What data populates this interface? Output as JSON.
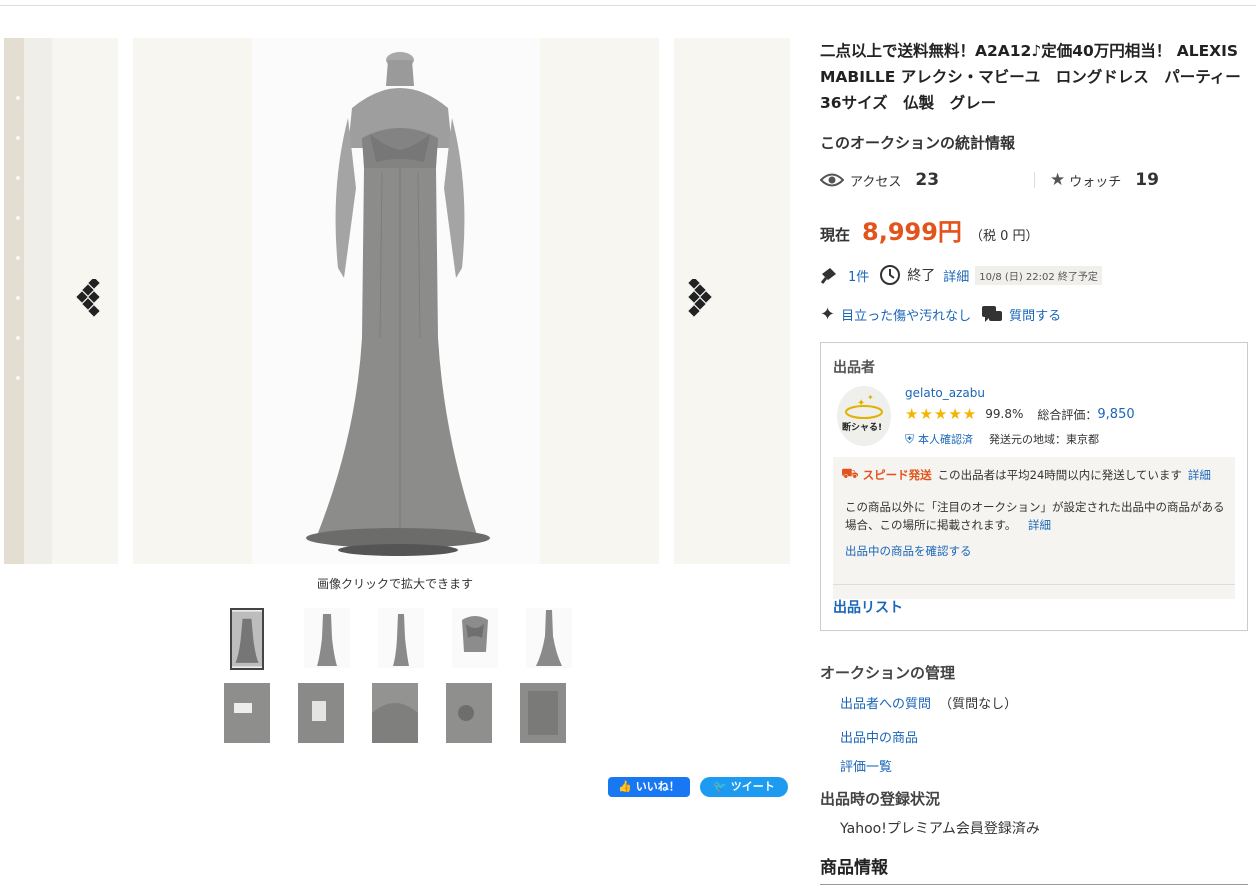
{
  "gallery": {
    "caption": "画像クリックで拡大できます",
    "prev_icon": "prev-arrow-icon",
    "next_icon": "next-arrow-icon",
    "thumbnail_count": 10,
    "selected_thumbnail": 1
  },
  "social": {
    "like_label": "いいね！",
    "tweet_label": "ツイート"
  },
  "item": {
    "title": "二点以上で送料無料！A2A12♪定価40万円相当！ ALEXIS MABILLE アレクシ・マビーユ　ロングドレス　パーティー　36サイズ　仏製　グレー"
  },
  "stats": {
    "heading": "このオークションの統計情報",
    "access_label": "アクセス",
    "access_value": "23",
    "watch_label": "ウォッチ",
    "watch_value": "19"
  },
  "price": {
    "label": "現在",
    "value": "8,999円",
    "tax": "（税 0 円）"
  },
  "bids": {
    "count": "1件",
    "end_label": "終了",
    "detail_link": "詳細",
    "end_time": "10/8 (日) 22:02 終了予定"
  },
  "condition": {
    "label": "目立った傷や汚れなし",
    "question_button": "質問する"
  },
  "seller": {
    "heading": "出品者",
    "avatar_text": "断シャる!",
    "name": "gelato_azabu",
    "stars": "★★★★★",
    "rating_pct": "99.8%",
    "total_label": "総合評価：",
    "total_value": "9,850",
    "verified_label": "本人確認済",
    "ship_from": "発送元の地域：東京都",
    "speed_tag": "スピード発送",
    "speed_text": "この出品者は平均24時間以内に発送しています",
    "speed_link": "詳細",
    "note": "この商品以外に「注目のオークション」が設定された出品中の商品がある場合、この場所に掲載されます。",
    "note_link": "詳細",
    "check_link": "出品中の商品を確認する",
    "listing_link": "出品リスト"
  },
  "management": {
    "heading": "オークションの管理",
    "question_link": "出品者への質問",
    "question_note": "（質問なし）",
    "listings_link": "出品中の商品",
    "reviews_link": "評価一覧"
  },
  "registration": {
    "heading": "出品時の登録状況",
    "value": "Yahoo!プレミアム会員登録済み"
  },
  "product_info": {
    "heading": "商品情報"
  },
  "colors": {
    "price": "#e2541b",
    "link": "#1a66b8",
    "star": "#f5b400"
  }
}
